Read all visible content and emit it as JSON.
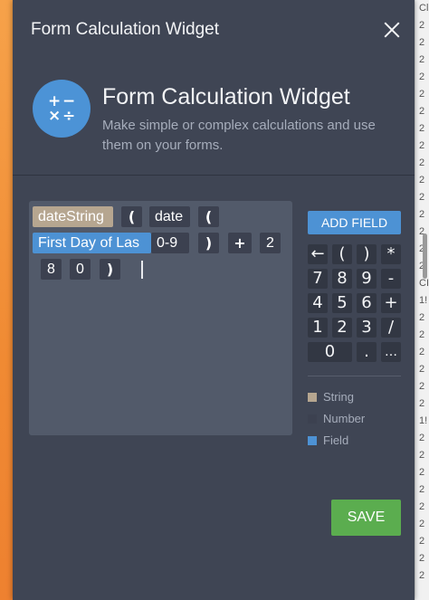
{
  "window": {
    "title": "Form Calculation Widget",
    "close_icon": "close-icon"
  },
  "header": {
    "icon": "calculator-icon",
    "icon_glyphs": [
      "+",
      "−",
      "×",
      "÷"
    ],
    "title": "Form Calculation Widget",
    "description": "Make simple or complex calculations and use them on your forms."
  },
  "editor": {
    "tokens": [
      {
        "text": "dateString",
        "kind": "string"
      },
      {
        "text": "(",
        "kind": "op"
      },
      {
        "text": "date",
        "kind": "number"
      },
      {
        "text": "(",
        "kind": "op"
      },
      {
        "text": "First Day of Las",
        "kind": "field"
      },
      {
        "text": "0-9",
        "kind": "number"
      },
      {
        "text": ")",
        "kind": "op"
      },
      {
        "text": "+",
        "kind": "op"
      },
      {
        "text": "2",
        "kind": "number"
      },
      {
        "text": "8",
        "kind": "number"
      },
      {
        "text": "0",
        "kind": "number"
      },
      {
        "text": ")",
        "kind": "op"
      }
    ]
  },
  "keypad": {
    "add_field": "ADD FIELD",
    "rows": [
      [
        "←",
        "(",
        ")",
        "*"
      ],
      [
        "7",
        "8",
        "9",
        "-"
      ],
      [
        "4",
        "5",
        "6",
        "+"
      ],
      [
        "1",
        "2",
        "3",
        "/"
      ],
      [
        "0",
        ".",
        "…"
      ]
    ],
    "backspace_icon": "backspace-arrow-icon",
    "more_icon": "ellipsis-icon"
  },
  "legend": [
    {
      "label": "String",
      "color": "#b6a690"
    },
    {
      "label": "Number",
      "color": "#3c4150"
    },
    {
      "label": "Field",
      "color": "#4d92d4"
    }
  ],
  "footer": {
    "save": "SAVE"
  },
  "background_page": {
    "right_column": [
      "Cl",
      "2",
      "2",
      "2",
      "2",
      "2",
      "2",
      "2",
      "2",
      "2",
      "2",
      "2",
      "2",
      "2",
      "2",
      "2",
      "CI",
      "1!",
      "2",
      "2",
      "2",
      "2",
      "2",
      "2",
      "1!",
      "2",
      "2",
      "2",
      "2",
      "2",
      "2",
      "2",
      "2",
      "2"
    ]
  },
  "colors": {
    "panel": "#3f4554",
    "accent": "#4d92d4",
    "save": "#5bad4f",
    "string": "#b6a690"
  }
}
